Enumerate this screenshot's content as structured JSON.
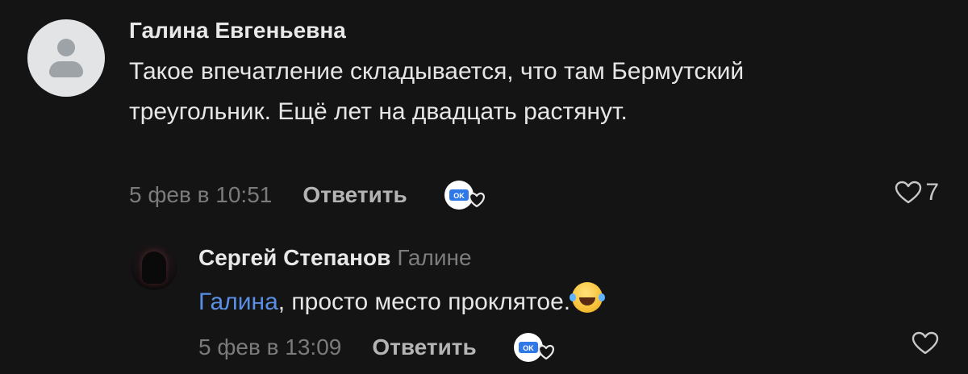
{
  "comments": [
    {
      "author": "Галина Евгеньевна",
      "text": "Такое впечатление складывается, что там Бермутский треугольник. Ещё лет на двадцать растянут.",
      "time": "5 фев в 10:51",
      "reply_label": "Ответить",
      "reaction_badge": "OK",
      "like_count": "7"
    },
    {
      "author": "Сергей Степанов",
      "reply_to": "Галине",
      "mention": "Галина",
      "text": ", просто место проклятое.",
      "time": "5 фев в 13:09",
      "reply_label": "Ответить",
      "reaction_badge": "OK"
    }
  ],
  "colors": {
    "background": "#141414",
    "mention": "#5a8fe6",
    "badge_blue": "#2f78e8"
  },
  "icons": {
    "default_avatar": "user-silhouette-icon",
    "reaction": "ok-heart-reaction-icon",
    "like": "heart-outline-icon",
    "emoji": "face-with-tears-of-joy-icon"
  }
}
